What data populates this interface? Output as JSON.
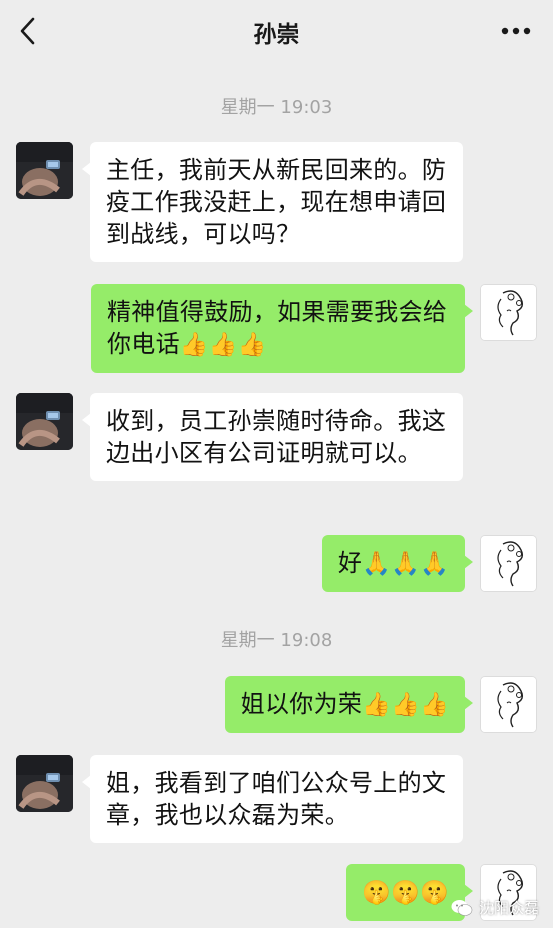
{
  "header": {
    "title": "孙崇"
  },
  "timestamps": [
    "星期一 19:03",
    "星期一 19:08"
  ],
  "messages": [
    {
      "side": "left",
      "text": "主任，我前天从新民回来的。防疫工作我没赶上，现在想申请回到战线，可以吗？"
    },
    {
      "side": "right",
      "text": "精神值得鼓励，如果需要我会给你电话",
      "emoji": "👍👍👍"
    },
    {
      "side": "left",
      "text": "收到，员工孙崇随时待命。我这边出小区有公司证明就可以。"
    },
    {
      "side": "right",
      "text": "好",
      "emoji": "🙏🙏🙏"
    },
    {
      "side": "right",
      "text": "姐以你为荣",
      "emoji": "👍👍👍"
    },
    {
      "side": "left",
      "text": "姐，我看到了咱们公众号上的文章，我也以众磊为荣。"
    },
    {
      "side": "right",
      "text": "",
      "emoji": "🤫🤫🤫"
    }
  ],
  "watermark": {
    "text": "沈阳众磊"
  },
  "icons": {
    "back": "chevron-left-icon",
    "more": "more-dots-icon"
  }
}
